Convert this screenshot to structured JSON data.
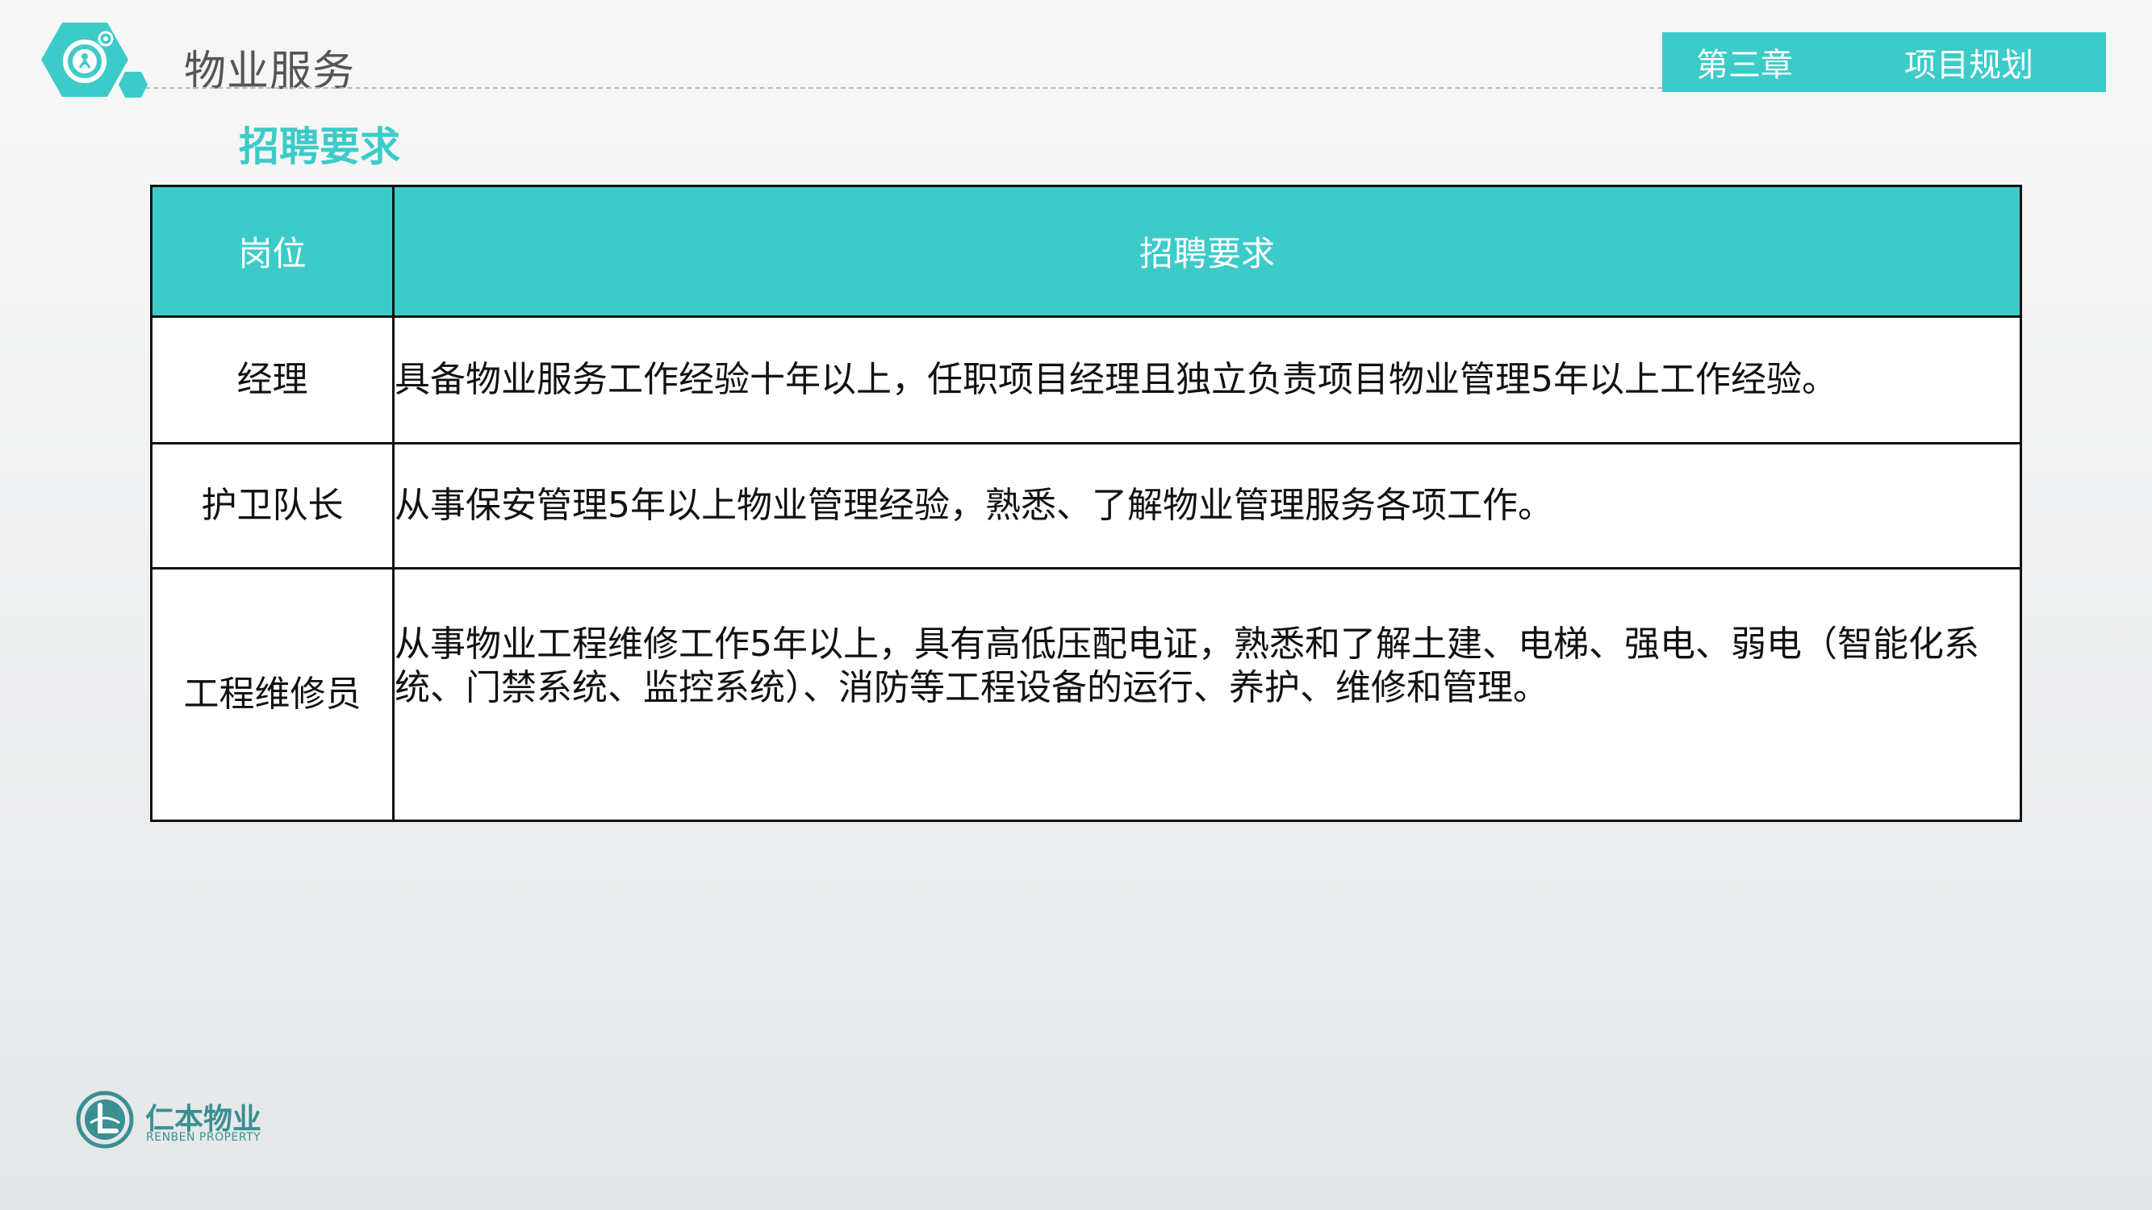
{
  "header": {
    "title": "物业服务",
    "chapter": "第三章",
    "topic": "项目规划"
  },
  "section": {
    "title": "招聘要求"
  },
  "table": {
    "columns": [
      "岗位",
      "招聘要求"
    ],
    "rows": [
      {
        "position": "经理",
        "requirement": "具备物业服务工作经验十年以上，任职项目经理且独立负责项目物业管理5年以上工作经验。"
      },
      {
        "position": "护卫队长",
        "requirement": "从事保安管理5年以上物业管理经验，熟悉、了解物业管理服务各项工作。"
      },
      {
        "position": "工程维修员",
        "requirement": "从事物业工程维修工作5年以上，具有高低压配电证，熟悉和了解土建、电梯、强电、弱电（智能化系统、门禁系统、监控系统）、消防等工程设备的运行、养护、维修和管理。"
      }
    ]
  },
  "footer": {
    "company_name": "仁本物业",
    "company_sub": "RENBEN PROPERTY"
  },
  "colors": {
    "accent": "#3ccbc8",
    "brand": "#3a8f93"
  },
  "icons": {
    "header_logo": "gear-worker-hexagon-icon",
    "footer_logo": "renben-circle-logo-icon"
  }
}
